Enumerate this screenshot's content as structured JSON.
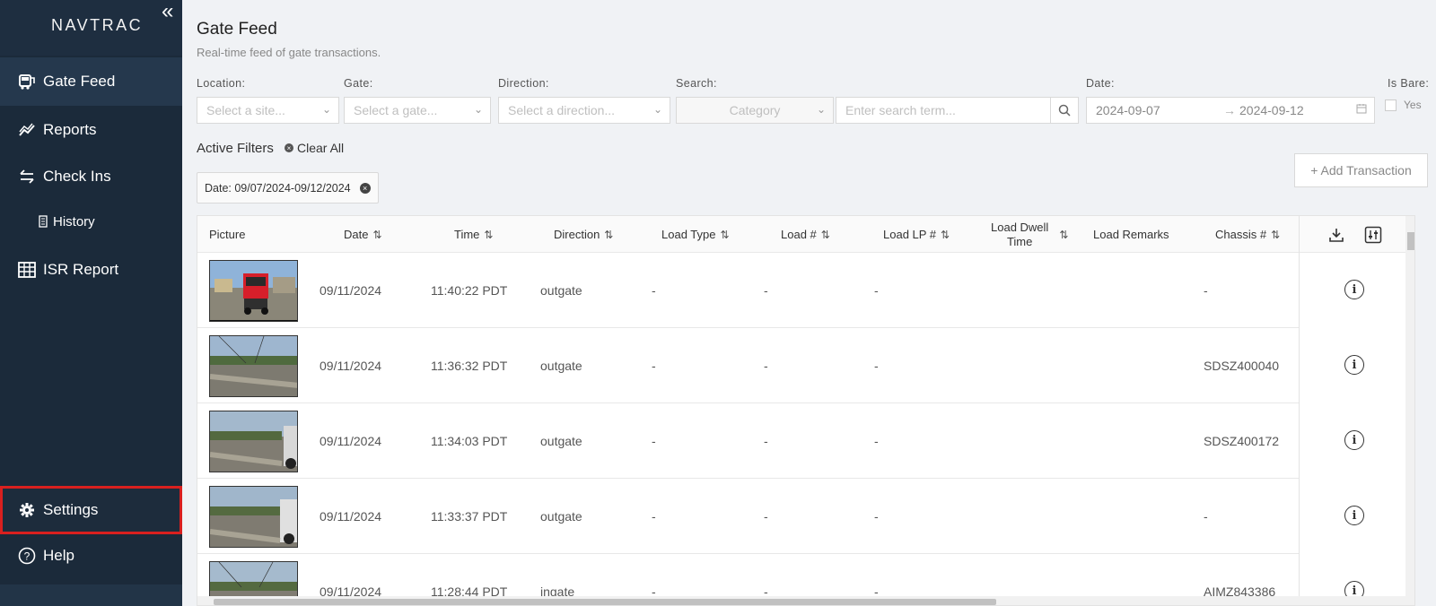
{
  "sidebar": {
    "logo": "NAVTRAC",
    "collapse": "«",
    "items": [
      {
        "label": "Gate Feed",
        "icon": "bus-icon"
      },
      {
        "label": "Reports",
        "icon": "chart-line-icon"
      },
      {
        "label": "Check Ins",
        "icon": "swap-arrows-icon"
      },
      {
        "label": "History",
        "icon": "document-icon"
      },
      {
        "label": "ISR Report",
        "icon": "table-icon"
      }
    ],
    "settings": "Settings",
    "help": "Help"
  },
  "header": {
    "title": "Gate Feed",
    "subtitle": "Real-time feed of gate transactions."
  },
  "filters": {
    "location_label": "Location:",
    "location_placeholder": "Select a site...",
    "gate_label": "Gate:",
    "gate_placeholder": "Select a gate...",
    "direction_label": "Direction:",
    "direction_placeholder": "Select a direction...",
    "search_label": "Search:",
    "category_placeholder": "Category",
    "search_placeholder": "Enter search term...",
    "date_label": "Date:",
    "date_from": "2024-09-07",
    "date_to": "2024-09-12",
    "date_sep": "→",
    "is_bare_label": "Is Bare:",
    "is_bare_option": "Yes"
  },
  "active_filters": {
    "label": "Active Filters",
    "clear_all": "Clear All",
    "chip": "Date: 09/07/2024-09/12/2024"
  },
  "add_transaction": "+ Add Transaction",
  "table": {
    "headers": {
      "picture": "Picture",
      "date": "Date",
      "time": "Time",
      "direction": "Direction",
      "load_type": "Load Type",
      "load_num": "Load #",
      "load_lp": "Load LP #",
      "load_dwell_1": "Load Dwell",
      "load_dwell_2": "Time",
      "load_remarks": "Load Remarks",
      "chassis": "Chassis #",
      "sort": "⇅"
    },
    "rows": [
      {
        "date": "09/11/2024",
        "time": "11:40:22 PDT",
        "direction": "outgate",
        "load_type": "-",
        "load_num": "-",
        "load_lp": "-",
        "chassis": "-"
      },
      {
        "date": "09/11/2024",
        "time": "11:36:32 PDT",
        "direction": "outgate",
        "load_type": "-",
        "load_num": "-",
        "load_lp": "-",
        "chassis": "SDSZ400040"
      },
      {
        "date": "09/11/2024",
        "time": "11:34:03 PDT",
        "direction": "outgate",
        "load_type": "-",
        "load_num": "-",
        "load_lp": "-",
        "chassis": "SDSZ400172"
      },
      {
        "date": "09/11/2024",
        "time": "11:33:37 PDT",
        "direction": "outgate",
        "load_type": "-",
        "load_num": "-",
        "load_lp": "-",
        "chassis": "-"
      },
      {
        "date": "09/11/2024",
        "time": "11:28:44 PDT",
        "direction": "ingate",
        "load_type": "-",
        "load_num": "-",
        "load_lp": "-",
        "chassis": "AIMZ843386"
      }
    ],
    "info_glyph": "i"
  },
  "colors": {
    "sidebar_bg": "#1b2a3a",
    "highlight": "#d9201f",
    "page_bg": "#f0f2f5"
  }
}
